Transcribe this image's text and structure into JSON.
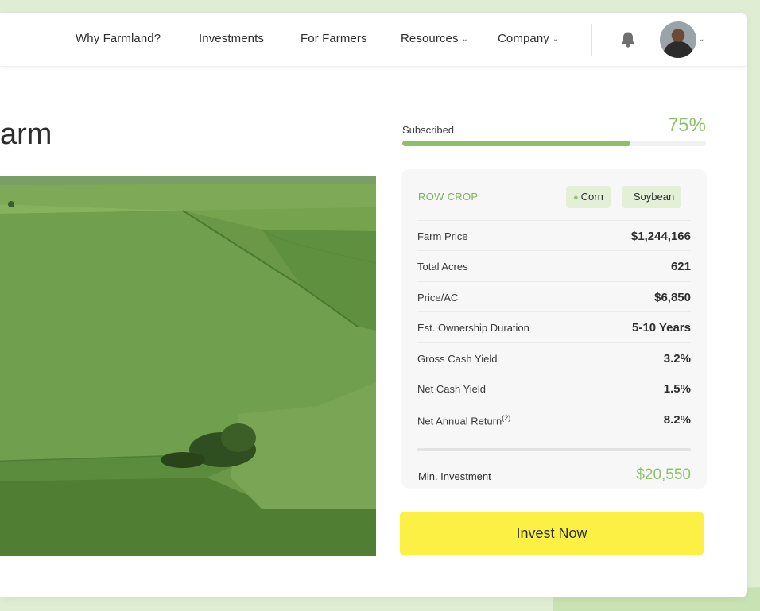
{
  "nav": {
    "items": [
      {
        "label": "Why Farmland?"
      },
      {
        "label": "Investments"
      },
      {
        "label": "For Farmers"
      },
      {
        "label": "Resources"
      },
      {
        "label": "Company"
      }
    ],
    "chevron": "⌄",
    "icons": {
      "notification": "bell-icon",
      "dropdown": "chevron-down-icon"
    }
  },
  "page": {
    "title": "arm"
  },
  "subscription": {
    "label": "Subscribed",
    "percent_text": "75%",
    "progress": 0.75
  },
  "card": {
    "category": "ROW CROP",
    "tags": [
      {
        "label": "Corn",
        "icon": "corn-icon"
      },
      {
        "label": "Soybean",
        "icon": "soybean-icon"
      }
    ],
    "rows": [
      {
        "label": "Farm Price",
        "value": "$1,244,166"
      },
      {
        "label": "Total Acres",
        "value": "621"
      },
      {
        "label": "Price/AC",
        "value": "$6,850"
      },
      {
        "label": "Est. Ownership Duration",
        "value": "5-10 Years"
      },
      {
        "label": "Gross Cash Yield",
        "value": "3.2%"
      },
      {
        "label": "Net Cash Yield",
        "value": "1.5%"
      },
      {
        "label": "Net Annual Return",
        "superscript": "(2)",
        "value": "8.2%"
      }
    ],
    "min_investment": {
      "label": "Min. Investment",
      "value": "$20,550"
    }
  },
  "cta": {
    "label": "Invest Now"
  },
  "colors": {
    "accent_green": "#8dc36b",
    "cta_yellow": "#fdf044",
    "tag_bg": "#e4efd8"
  }
}
